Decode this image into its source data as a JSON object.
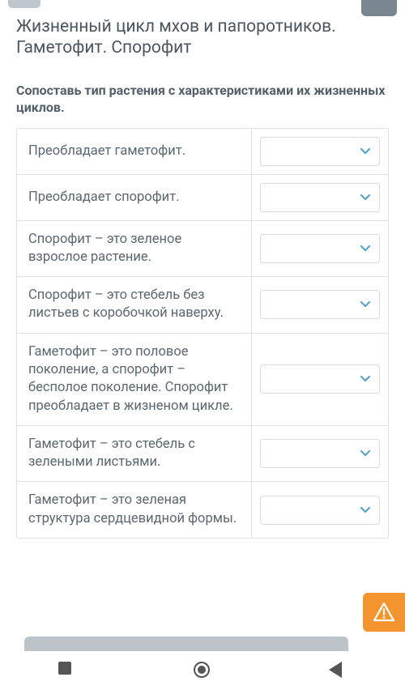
{
  "header": {
    "title": "Жизненный цикл мхов и папоротников. Гаметофит. Спорофит"
  },
  "instruction": "Сопоставь тип растения с характеристиками их жизненных циклов.",
  "rows": [
    {
      "text": "Преобладает гаметофит."
    },
    {
      "text": "Преобладает спорофит."
    },
    {
      "text": "Спорофит – это зеленое взрослое растение."
    },
    {
      "text": "Спорофит – это стебель без листьев с коробочкой наверху."
    },
    {
      "text": "Гаметофит – это половое поколение, а спорофит – бесполое поколение. Спорофит преобладает в жизненом цикле."
    },
    {
      "text": "Гаметофит – это стебель с зелеными листьями."
    },
    {
      "text": "Гаметофит – это зеленая структура сердцевидной формы."
    }
  ],
  "colors": {
    "accent_orange": "#f4942e",
    "chevron": "#5aa3c9"
  }
}
